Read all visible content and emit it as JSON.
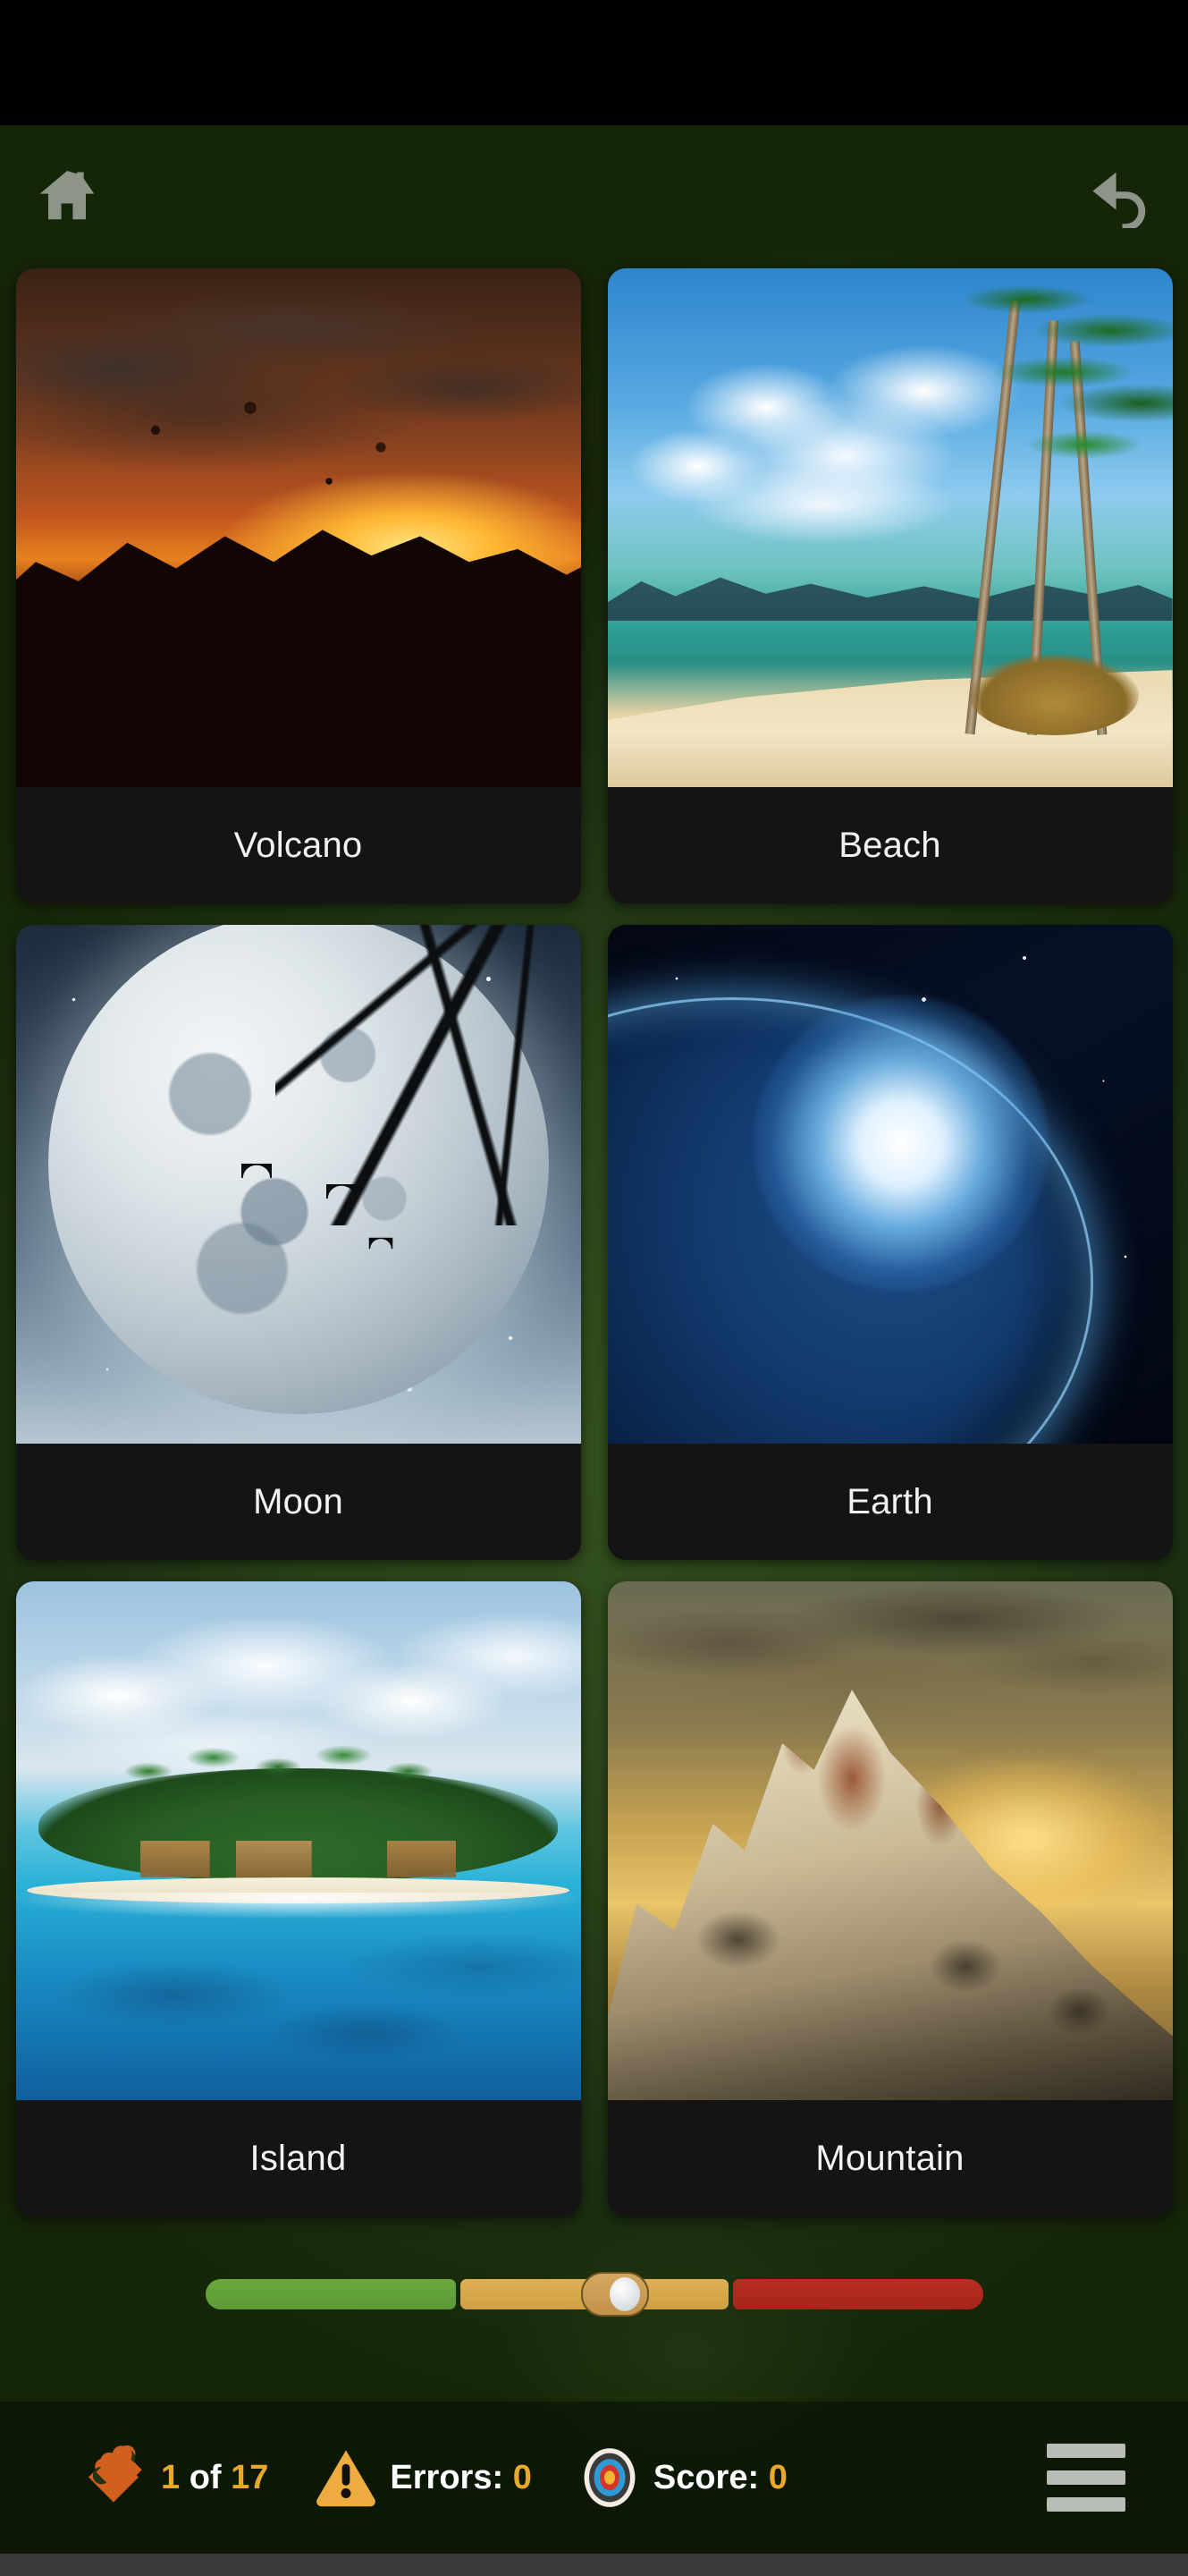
{
  "app": {
    "background_color": "#2b451a",
    "card_background": "#141414",
    "accent_color": "#e8a92b",
    "puzzle_color": "#d1601f"
  },
  "toolbar": {
    "home_label": "Home",
    "home_icon": "home-icon",
    "undo_label": "Undo",
    "undo_icon": "undo-arrow-icon"
  },
  "grid": {
    "cards": [
      {
        "label": "Volcano",
        "art": "volcano"
      },
      {
        "label": "Beach",
        "art": "beach"
      },
      {
        "label": "Moon",
        "art": "moon"
      },
      {
        "label": "Earth",
        "art": "earth"
      },
      {
        "label": "Island",
        "art": "island"
      },
      {
        "label": "Mountain",
        "art": "mountain"
      }
    ]
  },
  "difficulty_slider": {
    "name": "difficulty-slider",
    "segments": [
      "easy",
      "medium",
      "hard"
    ],
    "segment_colors": [
      "#5d9a35",
      "#cfa043",
      "#a6251a"
    ],
    "handle_position_percent": 48
  },
  "status_bar": {
    "progress": {
      "icon": "puzzle-piece-icon",
      "current": "1",
      "separator": "of",
      "total": "17"
    },
    "errors": {
      "icon": "warning-triangle-icon",
      "label": "Errors:",
      "value": "0"
    },
    "score": {
      "icon": "target-icon",
      "label": "Score:",
      "value": "0"
    },
    "menu": {
      "icon": "hamburger-menu-icon",
      "label": "Menu"
    }
  }
}
